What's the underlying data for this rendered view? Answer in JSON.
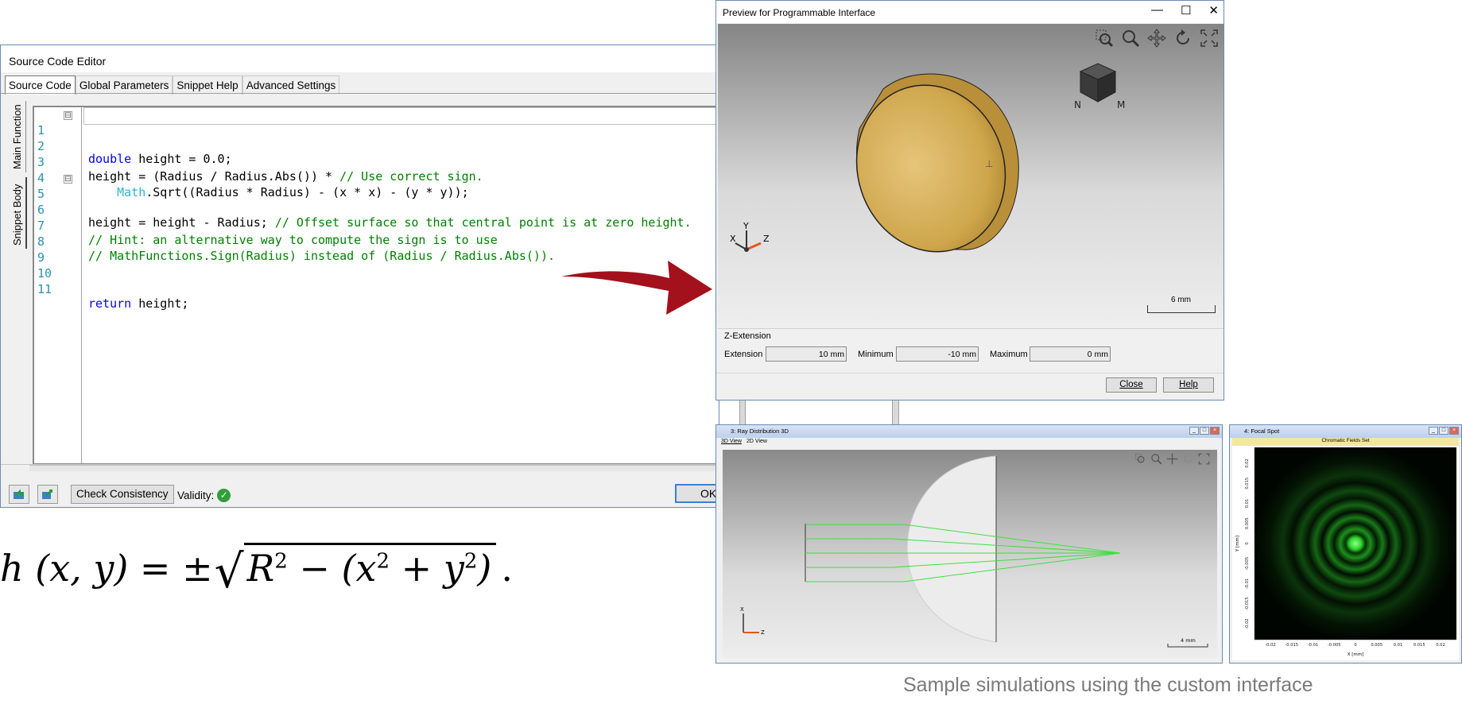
{
  "editor": {
    "title": "Source Code Editor",
    "tabs": [
      "Source Code",
      "Global Parameters",
      "Snippet Help",
      "Advanced Settings"
    ],
    "side_tabs": [
      "Main Function",
      "Snippet Body"
    ],
    "code_lines": [
      {
        "n": "1",
        "fold": "⊟"
      },
      {
        "n": "2"
      },
      {
        "n": "3"
      },
      {
        "n": "4"
      },
      {
        "n": "5",
        "fold": "⊟"
      },
      {
        "n": "6"
      },
      {
        "n": "7"
      },
      {
        "n": "8"
      },
      {
        "n": "9"
      },
      {
        "n": "10"
      },
      {
        "n": "11"
      }
    ],
    "code": {
      "l1_kw": "double",
      "l1_rest": " height = 0.0;",
      "l3_code": "height = (Radius / Radius.Abs()) * ",
      "l3_cm": "// Use correct sign.",
      "l4_indent": "    ",
      "l4_ty": "Math",
      "l4_rest": ".Sqrt((Radius * Radius) - (x * x) - (y * y));",
      "l5_code": "height = height - Radius; ",
      "l5_cm": "// Offset surface so that central point is at zero height.",
      "l7_cm": "// Hint: an alternative way to compute the sign is to use",
      "l8_cm": "// MathFunctions.Sign(Radius) instead of (Radius / Radius.Abs()).",
      "l11_kw": "return",
      "l11_rest": " height;"
    },
    "check_label": "Check Consistency",
    "validity_label": "Validity:",
    "validity_mark": "✓",
    "ok_label": "OK"
  },
  "formula": {
    "left": "h (x, y) = ±",
    "radicand_a": "R",
    "sup_a": "2",
    "mid": " − (x",
    "sup_b": "2",
    "mid2": " + y",
    "sup_c": "2",
    "close": ")",
    "end": "."
  },
  "preview": {
    "title": "Preview for Programmable Interface",
    "win_min": "—",
    "win_max": "☐",
    "win_close": "✕",
    "axis_labels": {
      "x": "X",
      "y": "Y",
      "z": "Z"
    },
    "scale_label": "6 mm",
    "zext_title": "Z-Extension",
    "extension_label": "Extension",
    "extension_value": "10 mm",
    "minimum_label": "Minimum",
    "minimum_value": "-10 mm",
    "maximum_label": "Maximum",
    "maximum_value": "0 mm",
    "close_label": "Close",
    "help_label": "Help"
  },
  "ray": {
    "title": "3: Ray Distribution 3D",
    "tabs": [
      "3D View",
      "2D View"
    ],
    "scale_label": "4 mm",
    "axis_labels": {
      "x": "X",
      "z": "Z"
    }
  },
  "focal": {
    "title": "4: Focal Spot",
    "subtitle": "Chromatic Fields Set",
    "x_axis_label": "X [mm]",
    "y_axis_label": "Y [mm]",
    "x_ticks": [
      "-0.02",
      "-0.015",
      "-0.01",
      "-0.005",
      "0",
      "0.005",
      "0.01",
      "0.015",
      "0.02"
    ],
    "y_ticks": [
      "0.02",
      "0.015",
      "0.01",
      "0.005",
      "0",
      "-0.005",
      "-0.01",
      "-0.015",
      "-0.02"
    ]
  },
  "caption": "Sample simulations using the custom interface",
  "colors": {
    "arrow": "#a3111c",
    "lens": "#d9b45a",
    "rays": "#3ee03e"
  }
}
